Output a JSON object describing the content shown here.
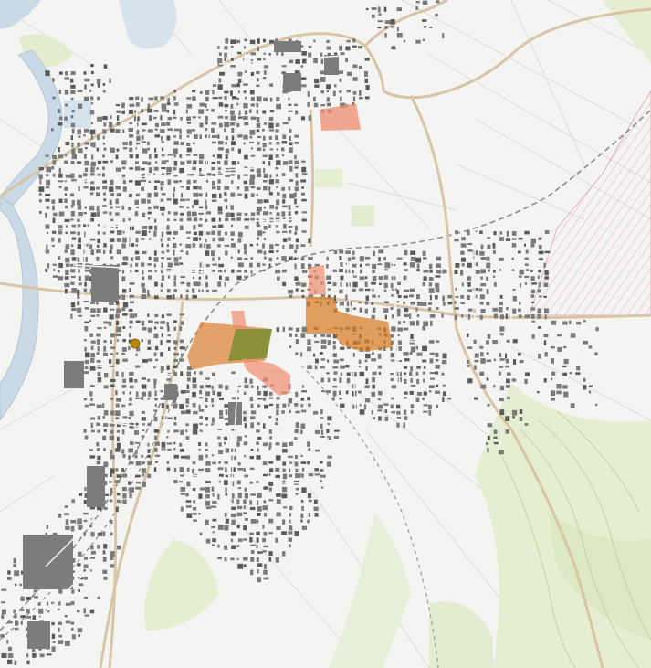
{
  "map": {
    "background": "#f4f4f2",
    "colors": {
      "land": "#f4f4f2",
      "field_line": "#dcdcd8",
      "building": "#6e6e6e",
      "building_dense": "#5a5a5a",
      "river": "#c9d9e6",
      "river_edge": "#a9bfd1",
      "road_major": "#d9c4a5",
      "road_minor": "#ffffff",
      "railway": "#7a7a7a",
      "green_light": "#e6eed2",
      "green_mid": "#d4e2b6",
      "contour": "#c6d0a4",
      "hatch": "#e7c8cf",
      "hatch_outline": "#d9a5b0",
      "highlight_salmon": "#f08c70",
      "highlight_orange": "#d9771e",
      "highlight_olive": "#6d8a2c",
      "marker": "#b8860b"
    },
    "highlighted_areas": [
      {
        "id": "north-commercial-plot",
        "color": "highlight_salmon"
      },
      {
        "id": "central-east-plot",
        "color": "highlight_orange"
      },
      {
        "id": "central-west-plot",
        "color": "highlight_orange"
      },
      {
        "id": "central-green-plot",
        "color": "highlight_olive"
      },
      {
        "id": "central-south-plot",
        "color": "highlight_salmon"
      },
      {
        "id": "central-small-plot",
        "color": "highlight_salmon"
      },
      {
        "id": "north-east-plot",
        "color": "highlight_salmon"
      }
    ],
    "point_marker": {
      "id": "circle-marker",
      "color": "marker"
    }
  }
}
